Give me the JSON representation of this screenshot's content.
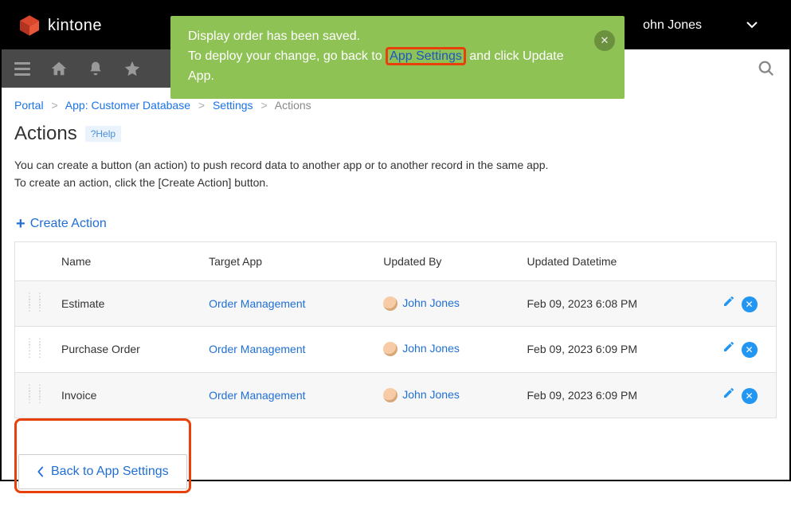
{
  "brand": "kintone",
  "user": {
    "name": "John Jones",
    "display": "ohn Jones"
  },
  "notification": {
    "line1": "Display order has been saved.",
    "line2_a": "To deploy your change, go back to ",
    "line2_link": "App Settings",
    "line2_b": " and click Update App."
  },
  "breadcrumb": {
    "portal": "Portal",
    "app": "App: Customer Database",
    "settings": "Settings",
    "current": "Actions"
  },
  "title": "Actions",
  "help_label": "?Help",
  "description": {
    "line1": "You can create a button (an action) to push record data to another app or to another record in the same app.",
    "line2": "To create an action, click the [Create Action] button."
  },
  "create_action_label": "Create Action",
  "columns": {
    "name": "Name",
    "target": "Target App",
    "updated_by": "Updated By",
    "updated_dt": "Updated Datetime"
  },
  "rows": [
    {
      "name": "Estimate",
      "target": "Order Management",
      "updated_by": "John Jones",
      "updated_dt": "Feb 09, 2023 6:08 PM"
    },
    {
      "name": "Purchase Order",
      "target": "Order Management",
      "updated_by": "John Jones",
      "updated_dt": "Feb 09, 2023 6:09 PM"
    },
    {
      "name": "Invoice",
      "target": "Order Management",
      "updated_by": "John Jones",
      "updated_dt": "Feb 09, 2023 6:09 PM"
    }
  ],
  "back_label": "Back to App Settings"
}
